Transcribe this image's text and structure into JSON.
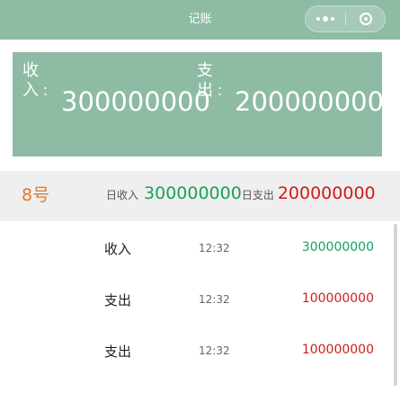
{
  "navbar": {
    "title": "记账",
    "more_icon": "more-dots-icon",
    "close_icon": "capsule-close-icon"
  },
  "summary": {
    "income_label": "收入",
    "income_colon": "：",
    "income_value": "300000000",
    "expense_label": "支出",
    "expense_colon": "：",
    "expense_value": "200000000"
  },
  "day": {
    "label": "8号",
    "income_label": "日收入",
    "income_value": "300000000",
    "expense_label": "日支出",
    "expense_value": "200000000"
  },
  "records": [
    {
      "type": "收入",
      "time": "12:32",
      "amount": "300000000",
      "color": "#1aa05e"
    },
    {
      "type": "支出",
      "time": "12:32",
      "amount": "100000000",
      "color": "#cf1c1c"
    },
    {
      "type": "支出",
      "time": "12:32",
      "amount": "100000000",
      "color": "#cf1c1c"
    }
  ],
  "colors": {
    "theme": "#8dbba3",
    "income": "#1aa05e",
    "expense": "#cf1c1c",
    "day": "#e07a2e"
  }
}
